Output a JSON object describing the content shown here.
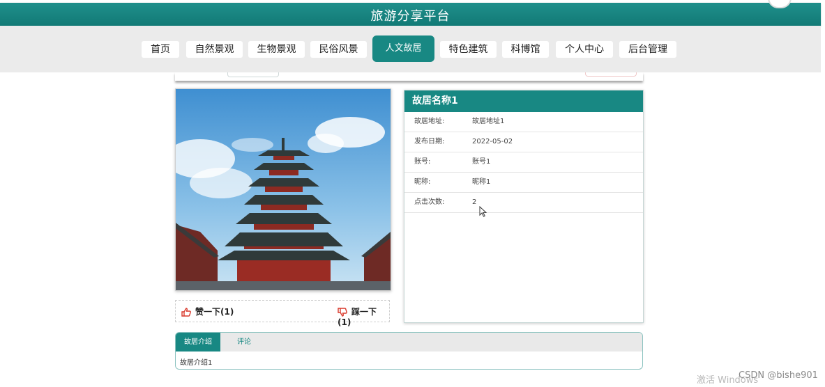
{
  "header": {
    "site_title": "旅游分享平台"
  },
  "nav": [
    {
      "label": "首页",
      "name": "nav-home"
    },
    {
      "label": "自然景观",
      "name": "nav-natural-scenery"
    },
    {
      "label": "生物景观",
      "name": "nav-biological-scenery"
    },
    {
      "label": "民俗风景",
      "name": "nav-folk-scenery"
    },
    {
      "label": "人文故居",
      "name": "nav-former-residences",
      "active": true
    },
    {
      "label": "特色建筑",
      "name": "nav-featured-architecture"
    },
    {
      "label": "科博馆",
      "name": "nav-science-museum"
    },
    {
      "label": "个人中心",
      "name": "nav-personal-center"
    },
    {
      "label": "后台管理",
      "name": "nav-admin"
    }
  ],
  "detail": {
    "title": "故居名称1",
    "fields": [
      {
        "label": "故居地址:",
        "value": "故居地址1"
      },
      {
        "label": "发布日期:",
        "value": "2022-05-02"
      },
      {
        "label": "账号:",
        "value": "账号1"
      },
      {
        "label": "昵称:",
        "value": "昵称1"
      },
      {
        "label": "点击次数:",
        "value": "2"
      }
    ]
  },
  "votes": {
    "like_label": "赞一下(1)",
    "dislike_label": "踩一下(1)",
    "like_color": "#d9382b",
    "dislike_color": "#d9382b"
  },
  "tabs": {
    "items": [
      {
        "label": "故居介绍",
        "active": true
      },
      {
        "label": "评论",
        "active": false
      }
    ],
    "content": "故居介绍1"
  },
  "watermark": {
    "activate_text": "激活 Windows",
    "csdn_text": "CSDN @bishe901"
  },
  "colors": {
    "brand": "#188883",
    "nav_band": "#ebebeb"
  }
}
